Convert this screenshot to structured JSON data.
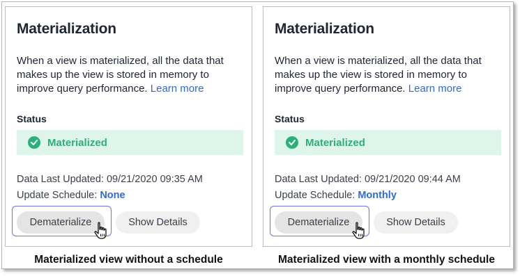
{
  "panels": [
    {
      "title": "Materialization",
      "description": "When a view is materialized, all the data that makes up the view is stored in memory to improve query performance.",
      "learn_more": "Learn more",
      "status_label": "Status",
      "status_value": "Materialized",
      "last_updated_label": "Data Last Updated:",
      "last_updated_value": "09/21/2020 09:35 AM",
      "schedule_label": "Update Schedule:",
      "schedule_value": "None",
      "dematerialize_label": "Dematerialize",
      "show_details_label": "Show Details"
    },
    {
      "title": "Materialization",
      "description": "When a view is materialized, all the data that makes up the view is stored in memory to improve query performance.",
      "learn_more": "Learn more",
      "status_label": "Status",
      "status_value": "Materialized",
      "last_updated_label": "Data Last Updated:",
      "last_updated_value": "09/21/2020 09:44 AM",
      "schedule_label": "Update Schedule:",
      "schedule_value": "Monthly",
      "dematerialize_label": "Dematerialize",
      "show_details_label": "Show Details"
    }
  ],
  "captions": [
    "Materialized view without a schedule",
    "Materialized view with a monthly schedule"
  ],
  "colors": {
    "accent": "#2f6ad9",
    "success": "#2bb07a",
    "success_bg": "#ddf5ea",
    "highlight": "#6f6df0"
  },
  "icons": [
    "check-circle-icon",
    "hand-pointer-icon"
  ]
}
